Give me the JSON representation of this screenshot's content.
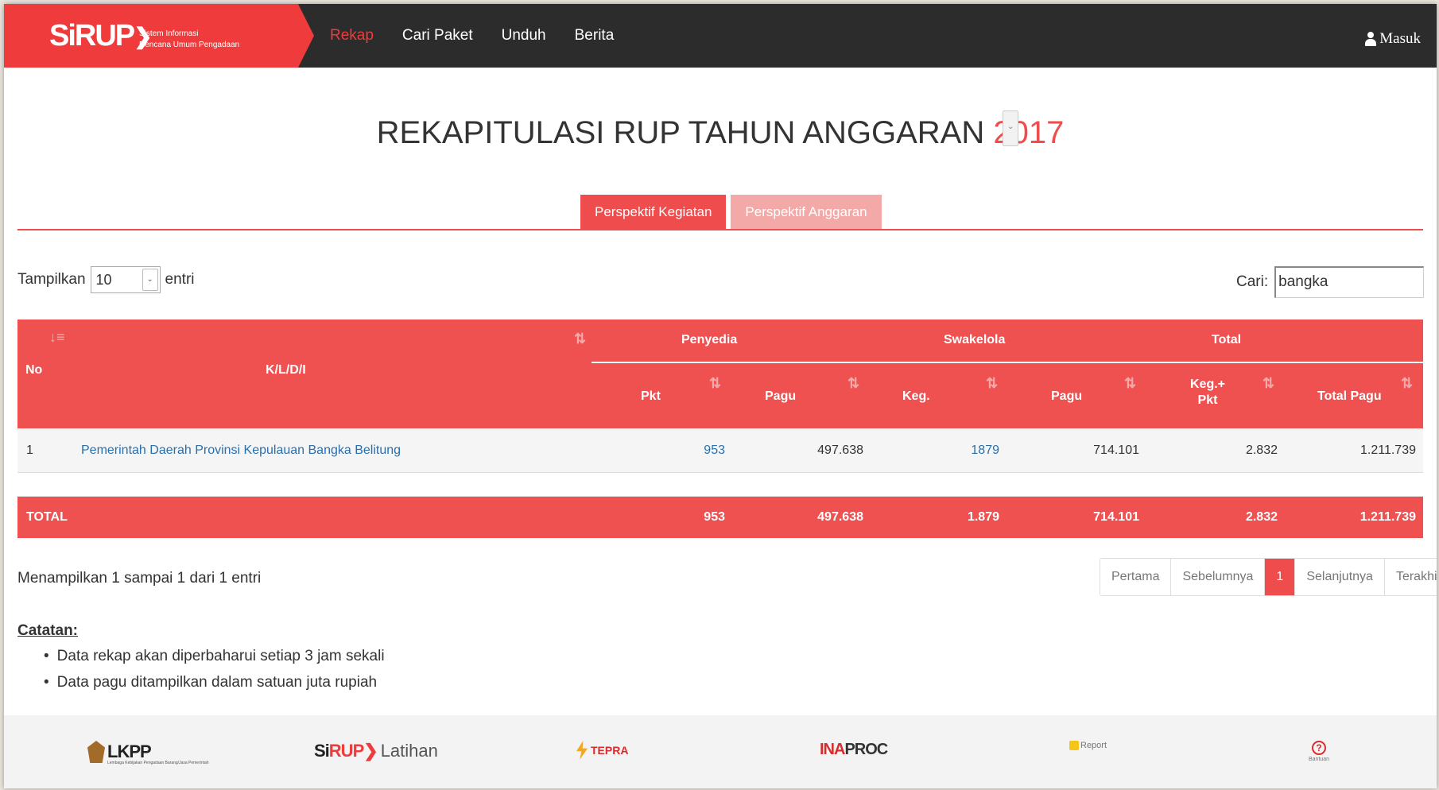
{
  "navbar": {
    "brand_si": "Si",
    "brand_rup": "RUP",
    "brand_line1": "Sistem Informasi",
    "brand_line2": "Rencana Umum Pengadaan",
    "links": [
      "Rekap",
      "Cari Paket",
      "Unduh",
      "Berita"
    ],
    "active_link": "Rekap",
    "login_label": "Masuk"
  },
  "title": {
    "text": "REKAPITULASI RUP TAHUN ANGGARAN",
    "year": "2017"
  },
  "tabs": [
    "Perspektif Kegiatan",
    "Perspektif Anggaran"
  ],
  "controls": {
    "show_label": "Tampilkan",
    "show_value": "10",
    "entries_label": "entri",
    "search_label": "Cari:",
    "search_value": "bangka"
  },
  "table": {
    "headers": {
      "no": "No",
      "kldi": "K/L/D/I",
      "penyedia": "Penyedia",
      "swakelola": "Swakelola",
      "total": "Total",
      "pkt": "Pkt",
      "pagu1": "Pagu",
      "keg": "Keg.",
      "pagu2": "Pagu",
      "kegpkt_line1": "Keg.+",
      "kegpkt_line2": "Pkt",
      "total_pagu": "Total Pagu"
    },
    "rows": [
      {
        "no": "1",
        "name": "Pemerintah Daerah Provinsi Kepulauan Bangka Belitung",
        "pkt": "953",
        "pagu": "497.638",
        "keg": "1879",
        "swa_pagu": "714.101",
        "kegpkt": "2.832",
        "total_pagu": "1.211.739"
      }
    ],
    "total": {
      "label": "TOTAL",
      "pkt": "953",
      "pagu": "497.638",
      "keg": "1.879",
      "swa_pagu": "714.101",
      "kegpkt": "2.832",
      "total_pagu": "1.211.739"
    }
  },
  "info": "Menampilkan 1 sampai 1 dari 1 entri",
  "pager": [
    "Pertama",
    "Sebelumnya",
    "1",
    "Selanjutnya",
    "Terakhir"
  ],
  "notes": {
    "title": "Catatan:",
    "items": [
      "Data rekap akan diperbaharui setiap 3 jam sekali",
      "Data pagu ditampilkan dalam satuan juta rupiah"
    ]
  },
  "footer": {
    "lkpp": "LKPP",
    "lkpp_sub": "Lembaga Kebijakan Pengadaan Barang/Jasa Pemerintah",
    "sirup_si": "Si",
    "sirup_rup": "RUP",
    "sirup_latihan": "Latihan",
    "tepra": "TEPRA",
    "inaproc_ina": "INA",
    "inaproc_proc": "PROC",
    "sireport": "Report",
    "bantuan": "Bantuan"
  },
  "colors": {
    "brand_red": "#ef3b3b",
    "table_red": "#ef5050",
    "navbar_bg": "#2c2c2c",
    "link_blue": "#2a6fad"
  }
}
